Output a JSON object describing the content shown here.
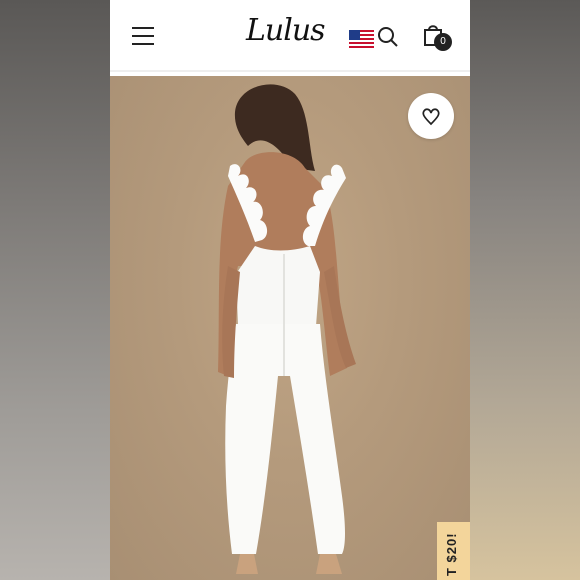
{
  "header": {
    "brand": "Lulus",
    "cart_count": "0",
    "icons": [
      "menu-icon",
      "us-flag-icon",
      "search-icon",
      "shopping-bag-icon"
    ]
  },
  "product_image": {
    "favorite_icon": "heart-icon"
  },
  "promo_tab": {
    "text": "T $20!"
  },
  "colors": {
    "header_bg": "#ffffff",
    "photo_bg": "#b49a7c",
    "promo_bg": "#f3d59b",
    "badge_bg": "#222222"
  }
}
